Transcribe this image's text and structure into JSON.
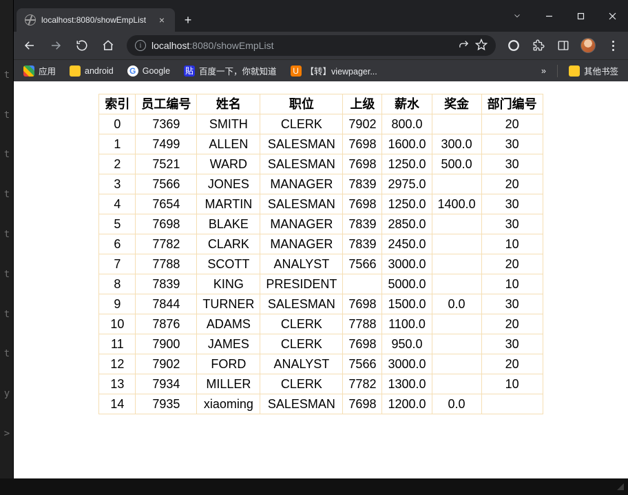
{
  "gutter": {
    "chars": [
      "t",
      "t",
      "t",
      "t",
      "t",
      "t",
      "t",
      "t",
      "y",
      ">"
    ]
  },
  "window": {
    "tab_title": "localhost:8080/showEmpList",
    "url": {
      "scheme_hint": "",
      "host": "localhost",
      "port": ":8080",
      "path": "/showEmpList"
    }
  },
  "bookmarks": {
    "apps": "应用",
    "items": [
      {
        "icon": "folder",
        "label": "android"
      },
      {
        "icon": "google",
        "label": "Google"
      },
      {
        "icon": "baidu",
        "label": "百度一下，你就知道"
      },
      {
        "icon": "u",
        "label": "【转】viewpager..."
      }
    ],
    "overflow": "»",
    "other": "其他书签"
  },
  "table": {
    "headers": [
      "索引",
      "员工编号",
      "姓名",
      "职位",
      "上级",
      "薪水",
      "奖金",
      "部门编号"
    ],
    "rows": [
      [
        "0",
        "7369",
        "SMITH",
        "CLERK",
        "7902",
        "800.0",
        "",
        "20"
      ],
      [
        "1",
        "7499",
        "ALLEN",
        "SALESMAN",
        "7698",
        "1600.0",
        "300.0",
        "30"
      ],
      [
        "2",
        "7521",
        "WARD",
        "SALESMAN",
        "7698",
        "1250.0",
        "500.0",
        "30"
      ],
      [
        "3",
        "7566",
        "JONES",
        "MANAGER",
        "7839",
        "2975.0",
        "",
        "20"
      ],
      [
        "4",
        "7654",
        "MARTIN",
        "SALESMAN",
        "7698",
        "1250.0",
        "1400.0",
        "30"
      ],
      [
        "5",
        "7698",
        "BLAKE",
        "MANAGER",
        "7839",
        "2850.0",
        "",
        "30"
      ],
      [
        "6",
        "7782",
        "CLARK",
        "MANAGER",
        "7839",
        "2450.0",
        "",
        "10"
      ],
      [
        "7",
        "7788",
        "SCOTT",
        "ANALYST",
        "7566",
        "3000.0",
        "",
        "20"
      ],
      [
        "8",
        "7839",
        "KING",
        "PRESIDENT",
        "",
        "5000.0",
        "",
        "10"
      ],
      [
        "9",
        "7844",
        "TURNER",
        "SALESMAN",
        "7698",
        "1500.0",
        "0.0",
        "30"
      ],
      [
        "10",
        "7876",
        "ADAMS",
        "CLERK",
        "7788",
        "1100.0",
        "",
        "20"
      ],
      [
        "11",
        "7900",
        "JAMES",
        "CLERK",
        "7698",
        "950.0",
        "",
        "30"
      ],
      [
        "12",
        "7902",
        "FORD",
        "ANALYST",
        "7566",
        "3000.0",
        "",
        "20"
      ],
      [
        "13",
        "7934",
        "MILLER",
        "CLERK",
        "7782",
        "1300.0",
        "",
        "10"
      ],
      [
        "14",
        "7935",
        "xiaoming",
        "SALESMAN",
        "7698",
        "1200.0",
        "0.0",
        ""
      ]
    ]
  }
}
